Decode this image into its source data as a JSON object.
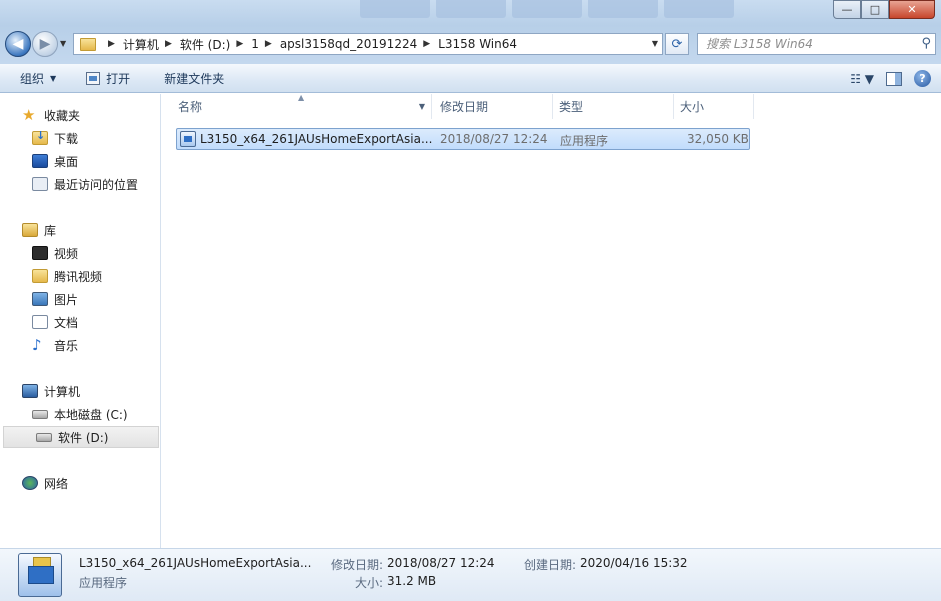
{
  "window": {
    "minimize": "—",
    "maximize": "□",
    "close": "✕"
  },
  "address": {
    "crumbs": [
      "计算机",
      "软件 (D:)",
      "1",
      "apsl3158qd_20191224",
      "L3158 Win64"
    ]
  },
  "search": {
    "placeholder": "搜索 L3158 Win64"
  },
  "toolbar": {
    "organize": "组织",
    "open": "打开",
    "new_folder": "新建文件夹"
  },
  "sidebar": {
    "favorites": "收藏夹",
    "downloads": "下载",
    "desktop": "桌面",
    "recent": "最近访问的位置",
    "libraries": "库",
    "videos": "视频",
    "tencent_video": "腾讯视频",
    "pictures": "图片",
    "documents": "文档",
    "music": "音乐",
    "computer": "计算机",
    "local_c": "本地磁盘 (C:)",
    "soft_d": "软件 (D:)",
    "network": "网络"
  },
  "columns": {
    "name": "名称",
    "modified": "修改日期",
    "type": "类型",
    "size": "大小"
  },
  "files": [
    {
      "name": "L3150_x64_261JAUsHomeExportAsia...",
      "modified": "2018/08/27 12:24",
      "type": "应用程序",
      "size": "32,050 KB"
    }
  ],
  "details": {
    "name": "L3150_x64_261JAUsHomeExportAsia...",
    "type": "应用程序",
    "modified_label": "修改日期:",
    "modified_value": "2018/08/27 12:24",
    "created_label": "创建日期:",
    "created_value": "2020/04/16 15:32",
    "size_label": "大小:",
    "size_value": "31.2 MB"
  }
}
